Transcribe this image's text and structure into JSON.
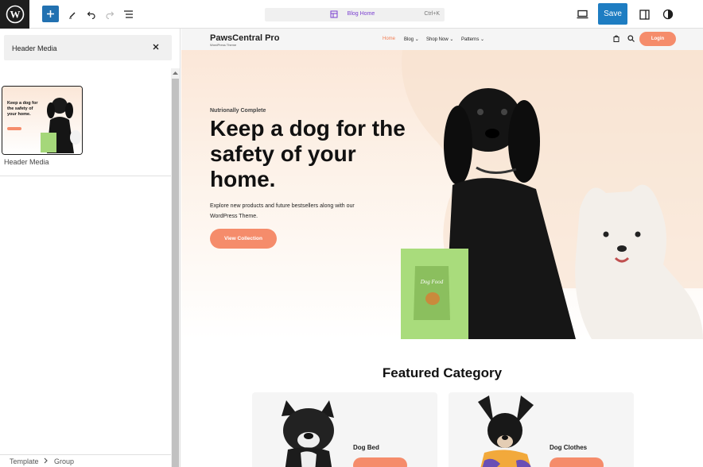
{
  "toolbar": {
    "document_title": "Blog Home",
    "shortcut": "Ctrl+K",
    "save_label": "Save"
  },
  "panel": {
    "header_label": "Header Media",
    "pattern_label": "Header Media",
    "thumbnail_title": "Keep a dog for the safety of your home."
  },
  "breadcrumb": {
    "items": [
      "Template",
      "Group"
    ]
  },
  "site": {
    "brand": "PawsCentral Pro",
    "brand_sub": "WordPress Theme",
    "nav": [
      "Home",
      "Blog",
      "Shop Now",
      "Patterns"
    ],
    "login_label": "Login"
  },
  "hero": {
    "kicker": "Nutrionally Complete",
    "title": "Keep a dog for the safety of your home.",
    "description": "Explore new products and future bestsellers along with our WordPress Theme.",
    "button_label": "View Collection",
    "bag_label": "Dog Food"
  },
  "featured": {
    "title": "Featured Category",
    "cards": [
      {
        "name": "Dog Bed"
      },
      {
        "name": "Dog Clothes"
      }
    ]
  },
  "colors": {
    "accent": "#f58c6b",
    "save": "#1e7dc2",
    "add": "#2271b1",
    "doc_title": "#7a3fd0"
  }
}
